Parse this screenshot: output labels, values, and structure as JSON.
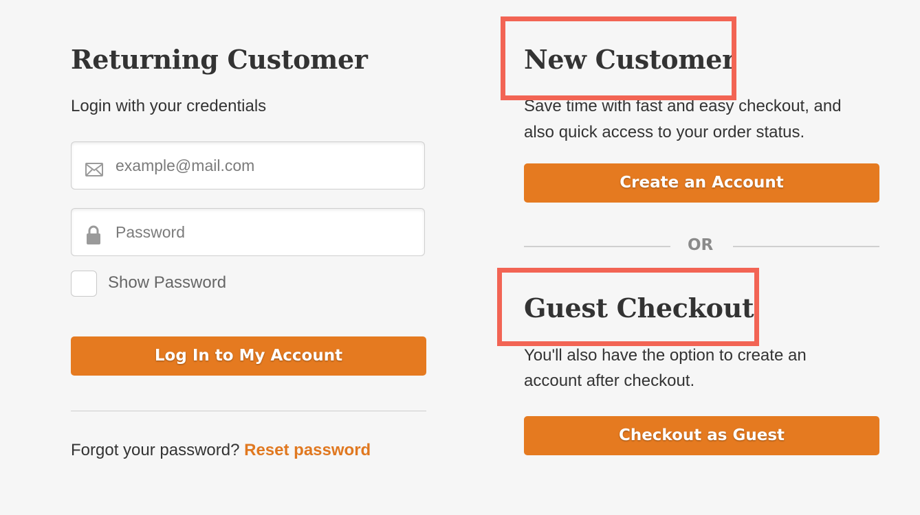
{
  "returning": {
    "title": "Returning Customer",
    "subtitle": "Login with your credentials",
    "email_placeholder": "example@mail.com",
    "password_placeholder": "Password",
    "show_password_label": "Show Password",
    "login_button": "Log In to My Account",
    "forgot_text": "Forgot your password?",
    "reset_link": "Reset password"
  },
  "new_customer": {
    "title": "New Customer",
    "description_line1": "Save time with fast and easy checkout, and",
    "description_line2": "also quick access to your order status.",
    "create_button": "Create an Account"
  },
  "separator": {
    "label": "OR"
  },
  "guest": {
    "title": "Guest Checkout",
    "description_line1": "You'll also have the option to create an",
    "description_line2": "account after checkout.",
    "checkout_button": "Checkout as Guest"
  },
  "icons": {
    "email": "envelope-icon",
    "password": "lock-icon"
  },
  "colors": {
    "accent": "#e57a20",
    "highlight_border": "#f26454",
    "background": "#f6f6f6",
    "text": "#333333"
  }
}
